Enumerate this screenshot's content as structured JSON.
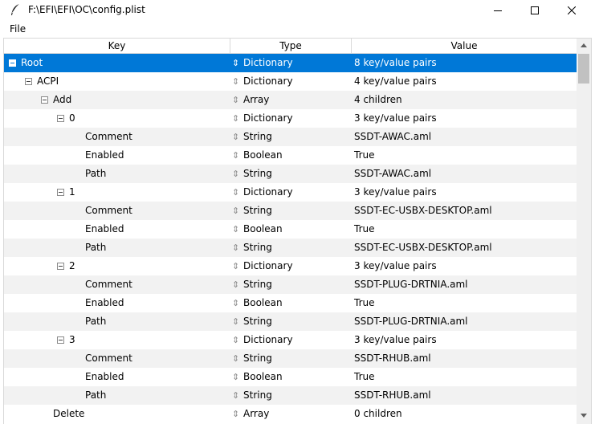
{
  "window": {
    "title": "F:\\EFI\\EFI\\OC\\config.plist",
    "icon": "quill-icon",
    "controls": [
      "minimize-icon",
      "maximize-icon",
      "close-icon"
    ]
  },
  "menubar": {
    "items": [
      {
        "label": "File"
      }
    ]
  },
  "columns": {
    "key": "Key",
    "type": "Type",
    "value": "Value"
  },
  "rows": [
    {
      "key": "Root",
      "type": "Dictionary",
      "value": "8 key/value pairs"
    },
    {
      "key": "ACPI",
      "type": "Dictionary",
      "value": "4 key/value pairs"
    },
    {
      "key": "Add",
      "type": "Array",
      "value": "4 children"
    },
    {
      "key": "0",
      "type": "Dictionary",
      "value": "3 key/value pairs"
    },
    {
      "key": "Comment",
      "type": "String",
      "value": "SSDT-AWAC.aml"
    },
    {
      "key": "Enabled",
      "type": "Boolean",
      "value": "True"
    },
    {
      "key": "Path",
      "type": "String",
      "value": "SSDT-AWAC.aml"
    },
    {
      "key": "1",
      "type": "Dictionary",
      "value": "3 key/value pairs"
    },
    {
      "key": "Comment",
      "type": "String",
      "value": "SSDT-EC-USBX-DESKTOP.aml"
    },
    {
      "key": "Enabled",
      "type": "Boolean",
      "value": "True"
    },
    {
      "key": "Path",
      "type": "String",
      "value": "SSDT-EC-USBX-DESKTOP.aml"
    },
    {
      "key": "2",
      "type": "Dictionary",
      "value": "3 key/value pairs"
    },
    {
      "key": "Comment",
      "type": "String",
      "value": "SSDT-PLUG-DRTNIA.aml"
    },
    {
      "key": "Enabled",
      "type": "Boolean",
      "value": "True"
    },
    {
      "key": "Path",
      "type": "String",
      "value": "SSDT-PLUG-DRTNIA.aml"
    },
    {
      "key": "3",
      "type": "Dictionary",
      "value": "3 key/value pairs"
    },
    {
      "key": "Comment",
      "type": "String",
      "value": "SSDT-RHUB.aml"
    },
    {
      "key": "Enabled",
      "type": "Boolean",
      "value": "True"
    },
    {
      "key": "Path",
      "type": "String",
      "value": "SSDT-RHUB.aml"
    },
    {
      "key": "Delete",
      "type": "Array",
      "value": "0 children"
    }
  ],
  "colors": {
    "selection": "#0078d7",
    "alt_row": "#f2f2f2"
  }
}
